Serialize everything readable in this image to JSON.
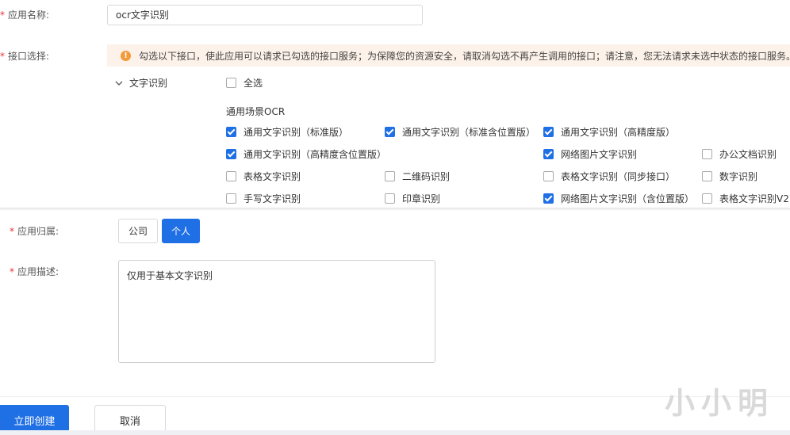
{
  "form": {
    "app_name": {
      "required_mark": "*",
      "label": "应用名称:",
      "value": "ocr文字识别"
    },
    "interface": {
      "required_mark": "*",
      "label": "接口选择:",
      "notice": "勾选以下接口，使此应用可以请求已勾选的接口服务；为保障您的资源安全，请取消勾选不再产生调用的接口；请注意，您无法请求未选中状态的接口服务。",
      "group_label": "文字识别",
      "select_all": "全选",
      "section_title": "通用场景OCR",
      "options": [
        {
          "label": "通用文字识别（标准版）",
          "checked": true
        },
        {
          "label": "通用文字识别（标准含位置版）",
          "checked": true
        },
        {
          "label": "通用文字识别（高精度版）",
          "checked": true
        },
        {
          "label": "通用文字识别（高精度含位置版）",
          "checked": true
        },
        {
          "label": "网络图片文字识别",
          "checked": true
        },
        {
          "label": "办公文档识别",
          "checked": false
        },
        {
          "label": "表格文字识别",
          "checked": false
        },
        {
          "label": "二维码识别",
          "checked": false
        },
        {
          "label": "表格文字识别（同步接口）",
          "checked": false
        },
        {
          "label": "数字识别",
          "checked": false
        },
        {
          "label": "手写文字识别",
          "checked": false
        },
        {
          "label": "印章识别",
          "checked": false
        },
        {
          "label": "网络图片文字识别（含位置版）",
          "checked": true
        },
        {
          "label": "表格文字识别V2",
          "checked": false
        }
      ]
    },
    "ownership": {
      "required_mark": "*",
      "label": "应用归属:",
      "options": [
        "公司",
        "个人"
      ],
      "selected": "个人"
    },
    "description": {
      "required_mark": "*",
      "label": "应用描述:",
      "value": "仅用于基本文字识别"
    }
  },
  "actions": {
    "create": "立即创建",
    "cancel": "取消"
  },
  "watermark": "小小明",
  "colors": {
    "primary": "#1f6fe5",
    "warning": "#f39a3b",
    "notice_bg": "#fdf2e9",
    "required": "#e33333"
  },
  "icons": {
    "warning": "exclamation-circle",
    "group_toggle": "chevron-down"
  }
}
